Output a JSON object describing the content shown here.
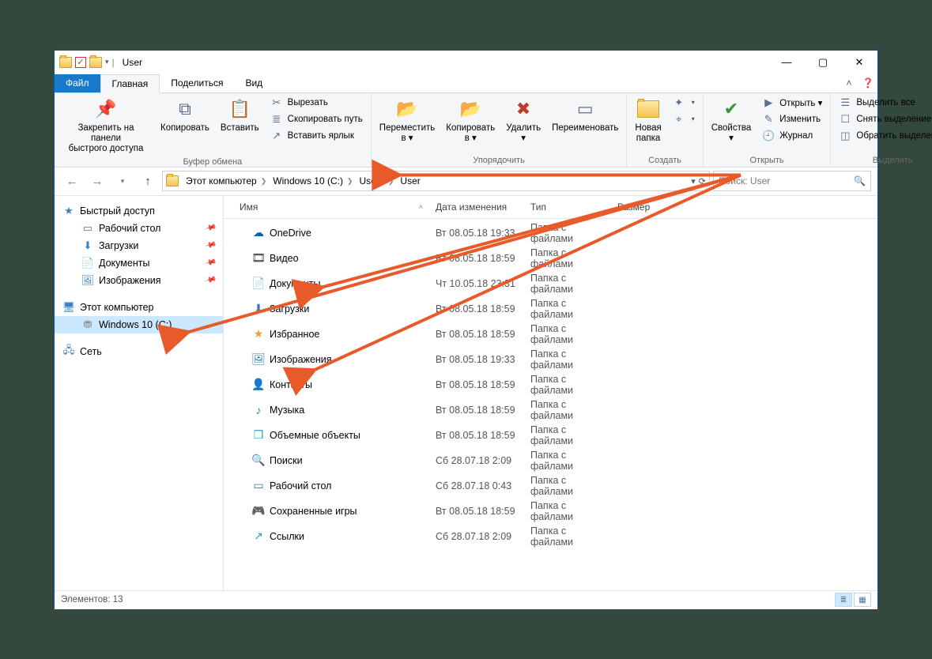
{
  "title": "User",
  "tabs": {
    "file": "Файл",
    "home": "Главная",
    "share": "Поделиться",
    "view": "Вид"
  },
  "ribbon": {
    "pin": "Закрепить на панели\nбыстрого доступа",
    "copy": "Копировать",
    "paste": "Вставить",
    "cut": "Вырезать",
    "copypath": "Скопировать путь",
    "pasteshortcut": "Вставить ярлык",
    "clipboard_label": "Буфер обмена",
    "moveto": "Переместить\nв ▾",
    "copyto": "Копировать\nв ▾",
    "delete": "Удалить\n▾",
    "rename": "Переименовать",
    "organize_label": "Упорядочить",
    "newfolder": "Новая\nпапка",
    "create_label": "Создать",
    "properties": "Свойства\n▾",
    "open": "Открыть ▾",
    "edit": "Изменить",
    "history": "Журнал",
    "open_label": "Открыть",
    "selectall": "Выделить все",
    "selectnone": "Снять выделение",
    "invertsel": "Обратить выделение",
    "select_label": "Выделить"
  },
  "breadcrumb": [
    "Этот компьютер",
    "Windows 10 (C:)",
    "Users",
    "User"
  ],
  "search_placeholder": "Поиск: User",
  "columns": {
    "name": "Имя",
    "date": "Дата изменения",
    "type": "Тип",
    "size": "Размер"
  },
  "sidebar": {
    "quick": "Быстрый доступ",
    "desktop": "Рабочий стол",
    "downloads": "Загрузки",
    "documents": "Документы",
    "pictures": "Изображения",
    "thispc": "Этот компьютер",
    "drive": "Windows 10 (C:)",
    "network": "Сеть"
  },
  "files": [
    {
      "icon": "☁",
      "color": "#0a64a4",
      "name": "OneDrive",
      "date": "Вт 08.05.18 19:33",
      "type": "Папка с файлами"
    },
    {
      "icon": "🎞",
      "color": "#333",
      "name": "Видео",
      "date": "Вт 08.05.18 18:59",
      "type": "Папка с файлами"
    },
    {
      "icon": "📄",
      "color": "#2e7cbe",
      "name": "Документы",
      "date": "Чт 10.05.18 23:31",
      "type": "Папка с файлами"
    },
    {
      "icon": "⬇",
      "color": "#2e7cbe",
      "name": "Загрузки",
      "date": "Вт 08.05.18 18:59",
      "type": "Папка с файлами"
    },
    {
      "icon": "★",
      "color": "#e8a33d",
      "name": "Избранное",
      "date": "Вт 08.05.18 18:59",
      "type": "Папка с файлами"
    },
    {
      "icon": "🖼",
      "color": "#2e7cbe",
      "name": "Изображения",
      "date": "Вт 08.05.18 19:33",
      "type": "Папка с файлами"
    },
    {
      "icon": "👤",
      "color": "#b08850",
      "name": "Контакты",
      "date": "Вт 08.05.18 18:59",
      "type": "Папка с файлами"
    },
    {
      "icon": "♪",
      "color": "#2e7cbe",
      "name": "Музыка",
      "date": "Вт 08.05.18 18:59",
      "type": "Папка с файлами"
    },
    {
      "icon": "❒",
      "color": "#2e9ecb",
      "name": "Объемные объекты",
      "date": "Вт 08.05.18 18:59",
      "type": "Папка с файлами"
    },
    {
      "icon": "🔍",
      "color": "#2e7cbe",
      "name": "Поиски",
      "date": "Сб 28.07.18 2:09",
      "type": "Папка с файлами"
    },
    {
      "icon": "▭",
      "color": "#2e7cbe",
      "name": "Рабочий стол",
      "date": "Сб 28.07.18 0:43",
      "type": "Папка с файлами"
    },
    {
      "icon": "🎮",
      "color": "#2e9ecb",
      "name": "Сохраненные игры",
      "date": "Вт 08.05.18 18:59",
      "type": "Папка с файлами"
    },
    {
      "icon": "↗",
      "color": "#2e9ecb",
      "name": "Ссылки",
      "date": "Сб 28.07.18 2:09",
      "type": "Папка с файлами"
    }
  ],
  "status": "Элементов: 13"
}
